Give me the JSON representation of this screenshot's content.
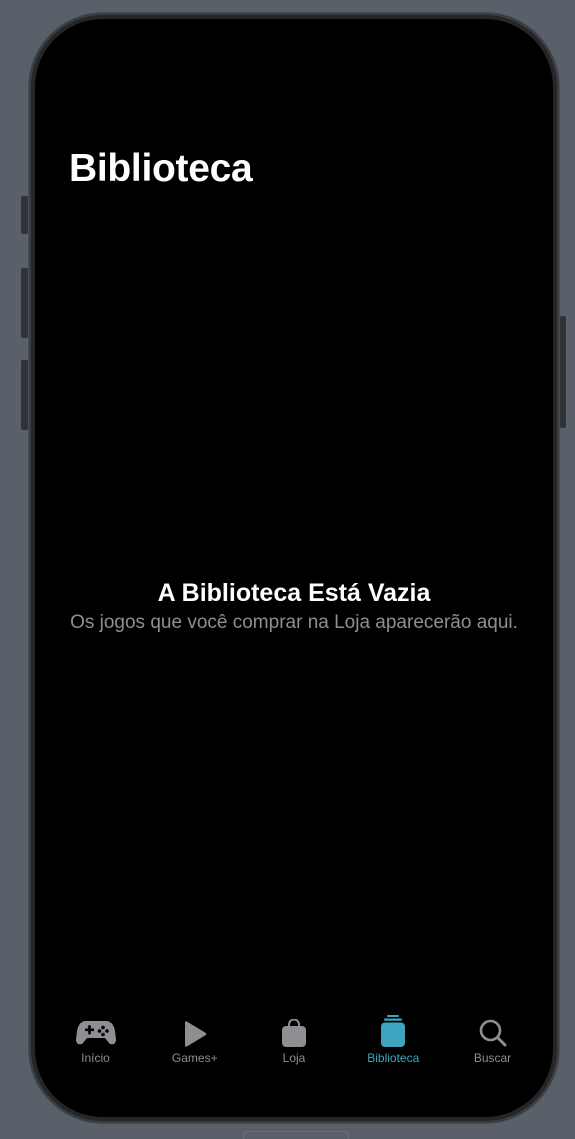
{
  "page": {
    "title": "Biblioteca"
  },
  "empty_state": {
    "title": "A Biblioteca Está Vazia",
    "message": "Os jogos que você comprar na Loja aparecerão aqui."
  },
  "tab_bar": {
    "items": [
      {
        "label": "Início",
        "icon": "gamecontroller-icon",
        "active": false
      },
      {
        "label": "Games+",
        "icon": "play-icon",
        "active": false
      },
      {
        "label": "Loja",
        "icon": "shopping-bag-icon",
        "active": false
      },
      {
        "label": "Biblioteca",
        "icon": "library-stack-icon",
        "active": true
      },
      {
        "label": "Buscar",
        "icon": "magnifying-glass-icon",
        "active": false
      }
    ]
  },
  "colors": {
    "background": "#000000",
    "accent": "#3fa4bf",
    "inactive": "#8e8e93",
    "text_primary": "#ffffff"
  }
}
